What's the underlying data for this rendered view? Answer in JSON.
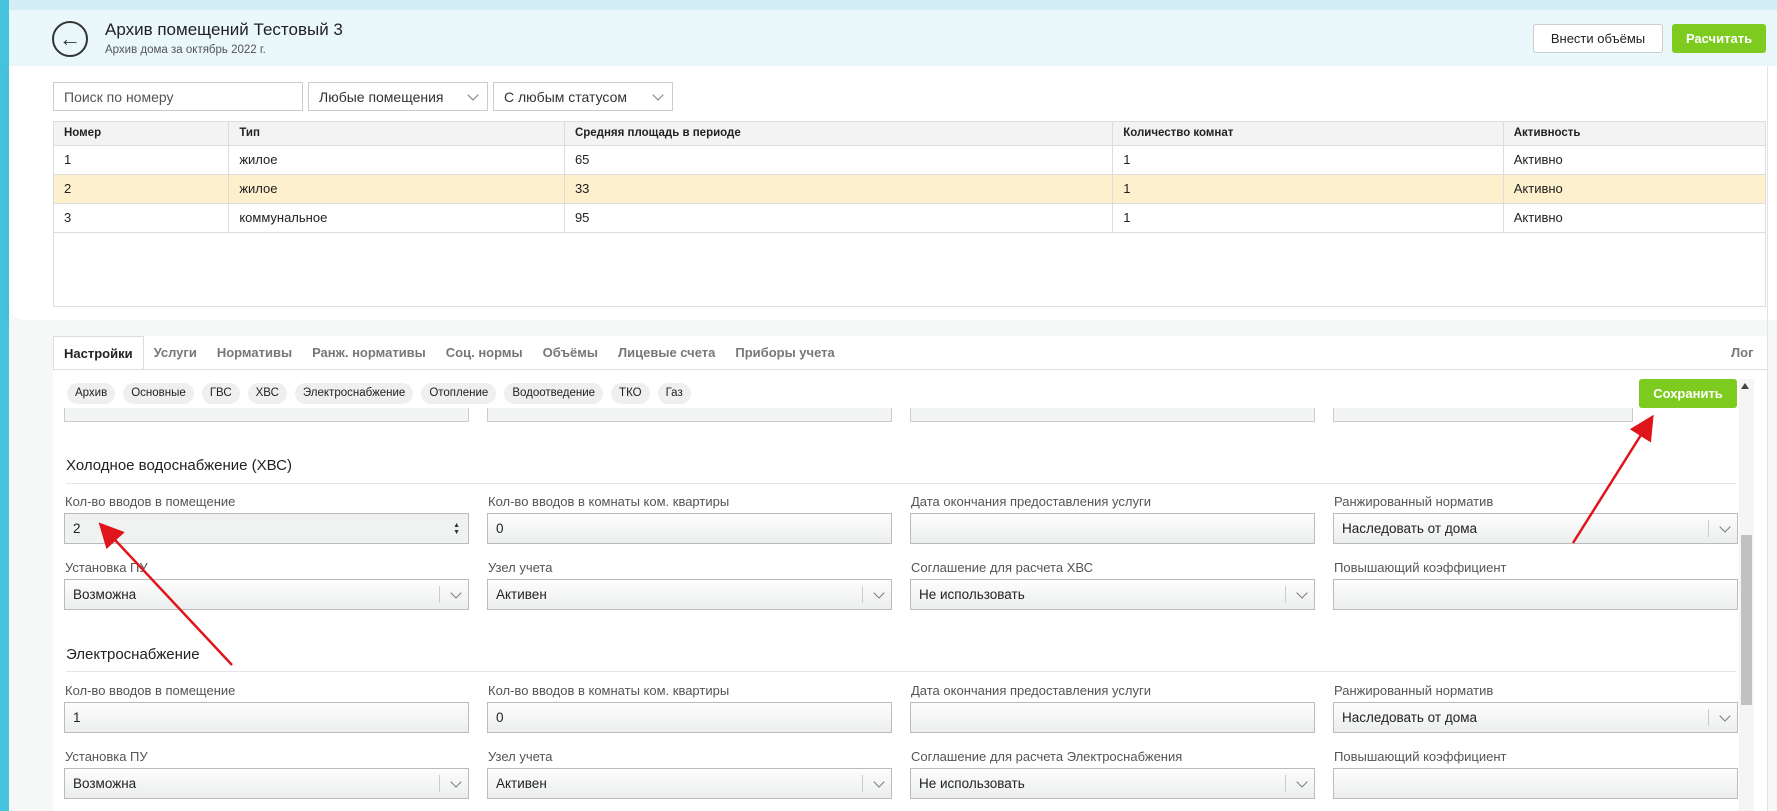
{
  "header": {
    "title": "Архив помещений Тестовый 3",
    "subtitle": "Архив дома за октябрь 2022 г.",
    "back_icon": "arrow-left-icon",
    "btn_volumes": "Внести объёмы",
    "btn_calc": "Расчитать"
  },
  "filters": {
    "search_placeholder": "Поиск по номеру",
    "room_type": "Любые помещения",
    "status": "С любым статусом"
  },
  "table": {
    "headers": [
      "Номер",
      "Тип",
      "Средняя площадь в периоде",
      "Количество комнат",
      "Активность"
    ],
    "rows": [
      [
        "1",
        "жилое",
        "65",
        "1",
        "Активно"
      ],
      [
        "2",
        "жилое",
        "33",
        "1",
        "Активно"
      ],
      [
        "3",
        "коммунальное",
        "95",
        "1",
        "Активно"
      ]
    ],
    "selected_row": 1
  },
  "tabs": {
    "items": [
      "Настройки",
      "Услуги",
      "Нормативы",
      "Ранж. нормативы",
      "Соц. нормы",
      "Объёмы",
      "Лицевые счета",
      "Приборы учета"
    ],
    "active": 0,
    "log": "Лог"
  },
  "chips": [
    "Архив",
    "Основные",
    "ГВС",
    "ХВС",
    "Электроснабжение",
    "Отопление",
    "Водоотведение",
    "ТКО",
    "Газ"
  ],
  "save_label": "Сохранить",
  "sections": [
    {
      "title": "Холодное водоснабжение (ХВС)",
      "fields": [
        {
          "label": "Кол-во вводов в помещение",
          "value": "2",
          "kind": "number-active"
        },
        {
          "label": "Кол-во вводов в комнаты ком. квартиры",
          "value": "0",
          "kind": "text"
        },
        {
          "label": "Дата окончания предоставления услуги",
          "value": "",
          "kind": "text"
        },
        {
          "label": "Ранжированный норматив",
          "value": "Наследовать от дома",
          "kind": "select"
        },
        {
          "label": "Установка ПУ",
          "value": "Возможна",
          "kind": "select"
        },
        {
          "label": "Узел учета",
          "value": "Активен",
          "kind": "select"
        },
        {
          "label": "Соглашение для расчета ХВС",
          "value": "Не использовать",
          "kind": "select"
        },
        {
          "label": "Повышающий коэффициент",
          "value": "",
          "kind": "text"
        }
      ]
    },
    {
      "title": "Электроснабжение",
      "fields": [
        {
          "label": "Кол-во вводов в помещение",
          "value": "1",
          "kind": "text"
        },
        {
          "label": "Кол-во вводов в комнаты ком. квартиры",
          "value": "0",
          "kind": "text"
        },
        {
          "label": "Дата окончания предоставления услуги",
          "value": "",
          "kind": "text"
        },
        {
          "label": "Ранжированный норматив",
          "value": "Наследовать от дома",
          "kind": "select"
        },
        {
          "label": "Установка ПУ",
          "value": "Возможна",
          "kind": "select"
        },
        {
          "label": "Узел учета",
          "value": "Активен",
          "kind": "select"
        },
        {
          "label": "Соглашение для расчета Электроснабжения",
          "value": "Не использовать",
          "kind": "select"
        },
        {
          "label": "Повышающий коэффициент",
          "value": "",
          "kind": "text"
        }
      ]
    }
  ],
  "colors": {
    "accent_green": "#7ecb20",
    "sidebar_blue": "#45c3de",
    "selected_row": "#fdf0cc",
    "annotation_arrow": "#e0141b"
  }
}
